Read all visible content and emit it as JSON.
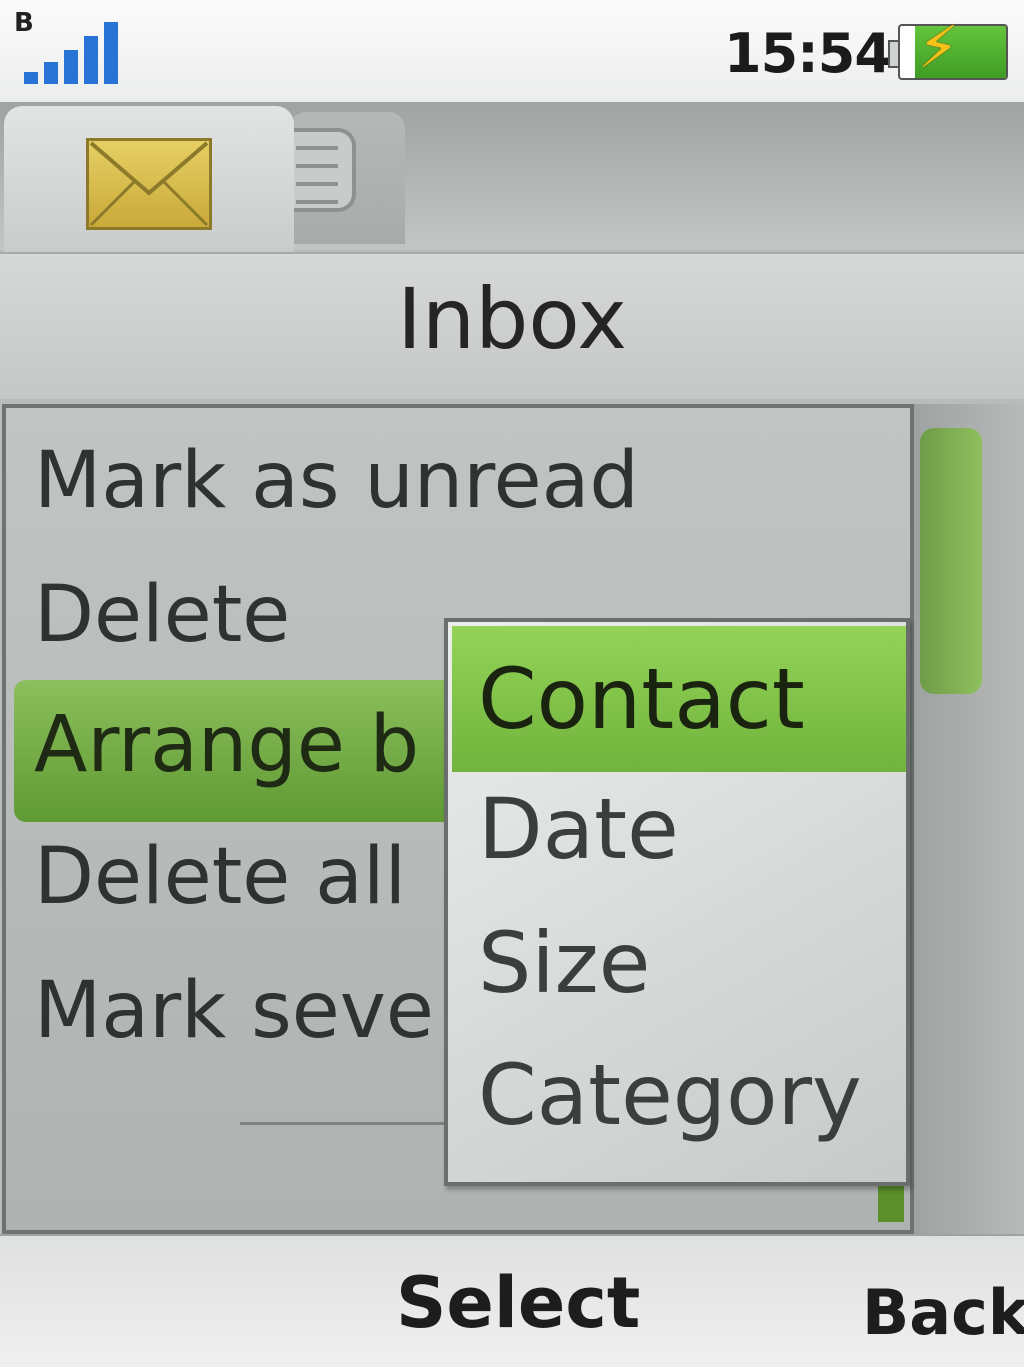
{
  "status": {
    "network_letter": "B",
    "time": "15:54",
    "battery_charging": true
  },
  "tabs": [
    {
      "name": "messages",
      "icon": "envelope-icon",
      "active": true
    },
    {
      "name": "notes",
      "icon": "note-icon",
      "active": false
    }
  ],
  "title": "Inbox",
  "menu": {
    "items": [
      {
        "label": "Mark as unread"
      },
      {
        "label": "Delete"
      },
      {
        "label": "Arrange b"
      },
      {
        "label": "Delete all"
      },
      {
        "label": "Mark seve"
      }
    ],
    "selected_index": 2
  },
  "submenu": {
    "items": [
      {
        "label": "Contact"
      },
      {
        "label": "Date"
      },
      {
        "label": "Size"
      },
      {
        "label": "Category"
      }
    ],
    "selected_index": 0
  },
  "softkeys": {
    "select": "Select",
    "back": "Back"
  },
  "colors": {
    "accent_green": "#6faf3a",
    "signal_blue": "#2a73d6"
  }
}
